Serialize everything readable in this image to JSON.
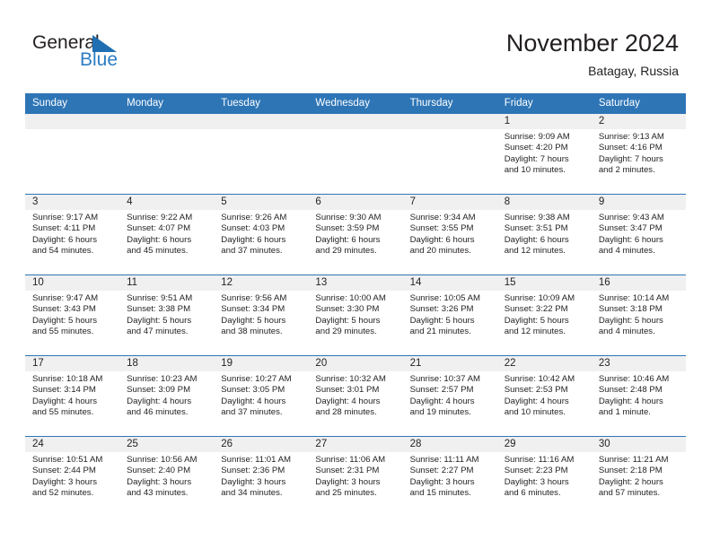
{
  "brand": {
    "name_part1": "General",
    "name_part2": "Blue",
    "accent_color": "#2b7cc4"
  },
  "header": {
    "title": "November 2024",
    "location": "Batagay, Russia",
    "header_bar_color": "#2e75b6",
    "daynum_band_color": "#f0f0f0"
  },
  "weekday_headers": [
    "Sunday",
    "Monday",
    "Tuesday",
    "Wednesday",
    "Thursday",
    "Friday",
    "Saturday"
  ],
  "weeks": [
    [
      {
        "day": "",
        "lines": []
      },
      {
        "day": "",
        "lines": []
      },
      {
        "day": "",
        "lines": []
      },
      {
        "day": "",
        "lines": []
      },
      {
        "day": "",
        "lines": []
      },
      {
        "day": "1",
        "lines": [
          "Sunrise: 9:09 AM",
          "Sunset: 4:20 PM",
          "Daylight: 7 hours",
          "and 10 minutes."
        ]
      },
      {
        "day": "2",
        "lines": [
          "Sunrise: 9:13 AM",
          "Sunset: 4:16 PM",
          "Daylight: 7 hours",
          "and 2 minutes."
        ]
      }
    ],
    [
      {
        "day": "3",
        "lines": [
          "Sunrise: 9:17 AM",
          "Sunset: 4:11 PM",
          "Daylight: 6 hours",
          "and 54 minutes."
        ]
      },
      {
        "day": "4",
        "lines": [
          "Sunrise: 9:22 AM",
          "Sunset: 4:07 PM",
          "Daylight: 6 hours",
          "and 45 minutes."
        ]
      },
      {
        "day": "5",
        "lines": [
          "Sunrise: 9:26 AM",
          "Sunset: 4:03 PM",
          "Daylight: 6 hours",
          "and 37 minutes."
        ]
      },
      {
        "day": "6",
        "lines": [
          "Sunrise: 9:30 AM",
          "Sunset: 3:59 PM",
          "Daylight: 6 hours",
          "and 29 minutes."
        ]
      },
      {
        "day": "7",
        "lines": [
          "Sunrise: 9:34 AM",
          "Sunset: 3:55 PM",
          "Daylight: 6 hours",
          "and 20 minutes."
        ]
      },
      {
        "day": "8",
        "lines": [
          "Sunrise: 9:38 AM",
          "Sunset: 3:51 PM",
          "Daylight: 6 hours",
          "and 12 minutes."
        ]
      },
      {
        "day": "9",
        "lines": [
          "Sunrise: 9:43 AM",
          "Sunset: 3:47 PM",
          "Daylight: 6 hours",
          "and 4 minutes."
        ]
      }
    ],
    [
      {
        "day": "10",
        "lines": [
          "Sunrise: 9:47 AM",
          "Sunset: 3:43 PM",
          "Daylight: 5 hours",
          "and 55 minutes."
        ]
      },
      {
        "day": "11",
        "lines": [
          "Sunrise: 9:51 AM",
          "Sunset: 3:38 PM",
          "Daylight: 5 hours",
          "and 47 minutes."
        ]
      },
      {
        "day": "12",
        "lines": [
          "Sunrise: 9:56 AM",
          "Sunset: 3:34 PM",
          "Daylight: 5 hours",
          "and 38 minutes."
        ]
      },
      {
        "day": "13",
        "lines": [
          "Sunrise: 10:00 AM",
          "Sunset: 3:30 PM",
          "Daylight: 5 hours",
          "and 29 minutes."
        ]
      },
      {
        "day": "14",
        "lines": [
          "Sunrise: 10:05 AM",
          "Sunset: 3:26 PM",
          "Daylight: 5 hours",
          "and 21 minutes."
        ]
      },
      {
        "day": "15",
        "lines": [
          "Sunrise: 10:09 AM",
          "Sunset: 3:22 PM",
          "Daylight: 5 hours",
          "and 12 minutes."
        ]
      },
      {
        "day": "16",
        "lines": [
          "Sunrise: 10:14 AM",
          "Sunset: 3:18 PM",
          "Daylight: 5 hours",
          "and 4 minutes."
        ]
      }
    ],
    [
      {
        "day": "17",
        "lines": [
          "Sunrise: 10:18 AM",
          "Sunset: 3:14 PM",
          "Daylight: 4 hours",
          "and 55 minutes."
        ]
      },
      {
        "day": "18",
        "lines": [
          "Sunrise: 10:23 AM",
          "Sunset: 3:09 PM",
          "Daylight: 4 hours",
          "and 46 minutes."
        ]
      },
      {
        "day": "19",
        "lines": [
          "Sunrise: 10:27 AM",
          "Sunset: 3:05 PM",
          "Daylight: 4 hours",
          "and 37 minutes."
        ]
      },
      {
        "day": "20",
        "lines": [
          "Sunrise: 10:32 AM",
          "Sunset: 3:01 PM",
          "Daylight: 4 hours",
          "and 28 minutes."
        ]
      },
      {
        "day": "21",
        "lines": [
          "Sunrise: 10:37 AM",
          "Sunset: 2:57 PM",
          "Daylight: 4 hours",
          "and 19 minutes."
        ]
      },
      {
        "day": "22",
        "lines": [
          "Sunrise: 10:42 AM",
          "Sunset: 2:53 PM",
          "Daylight: 4 hours",
          "and 10 minutes."
        ]
      },
      {
        "day": "23",
        "lines": [
          "Sunrise: 10:46 AM",
          "Sunset: 2:48 PM",
          "Daylight: 4 hours",
          "and 1 minute."
        ]
      }
    ],
    [
      {
        "day": "24",
        "lines": [
          "Sunrise: 10:51 AM",
          "Sunset: 2:44 PM",
          "Daylight: 3 hours",
          "and 52 minutes."
        ]
      },
      {
        "day": "25",
        "lines": [
          "Sunrise: 10:56 AM",
          "Sunset: 2:40 PM",
          "Daylight: 3 hours",
          "and 43 minutes."
        ]
      },
      {
        "day": "26",
        "lines": [
          "Sunrise: 11:01 AM",
          "Sunset: 2:36 PM",
          "Daylight: 3 hours",
          "and 34 minutes."
        ]
      },
      {
        "day": "27",
        "lines": [
          "Sunrise: 11:06 AM",
          "Sunset: 2:31 PM",
          "Daylight: 3 hours",
          "and 25 minutes."
        ]
      },
      {
        "day": "28",
        "lines": [
          "Sunrise: 11:11 AM",
          "Sunset: 2:27 PM",
          "Daylight: 3 hours",
          "and 15 minutes."
        ]
      },
      {
        "day": "29",
        "lines": [
          "Sunrise: 11:16 AM",
          "Sunset: 2:23 PM",
          "Daylight: 3 hours",
          "and 6 minutes."
        ]
      },
      {
        "day": "30",
        "lines": [
          "Sunrise: 11:21 AM",
          "Sunset: 2:18 PM",
          "Daylight: 2 hours",
          "and 57 minutes."
        ]
      }
    ]
  ]
}
